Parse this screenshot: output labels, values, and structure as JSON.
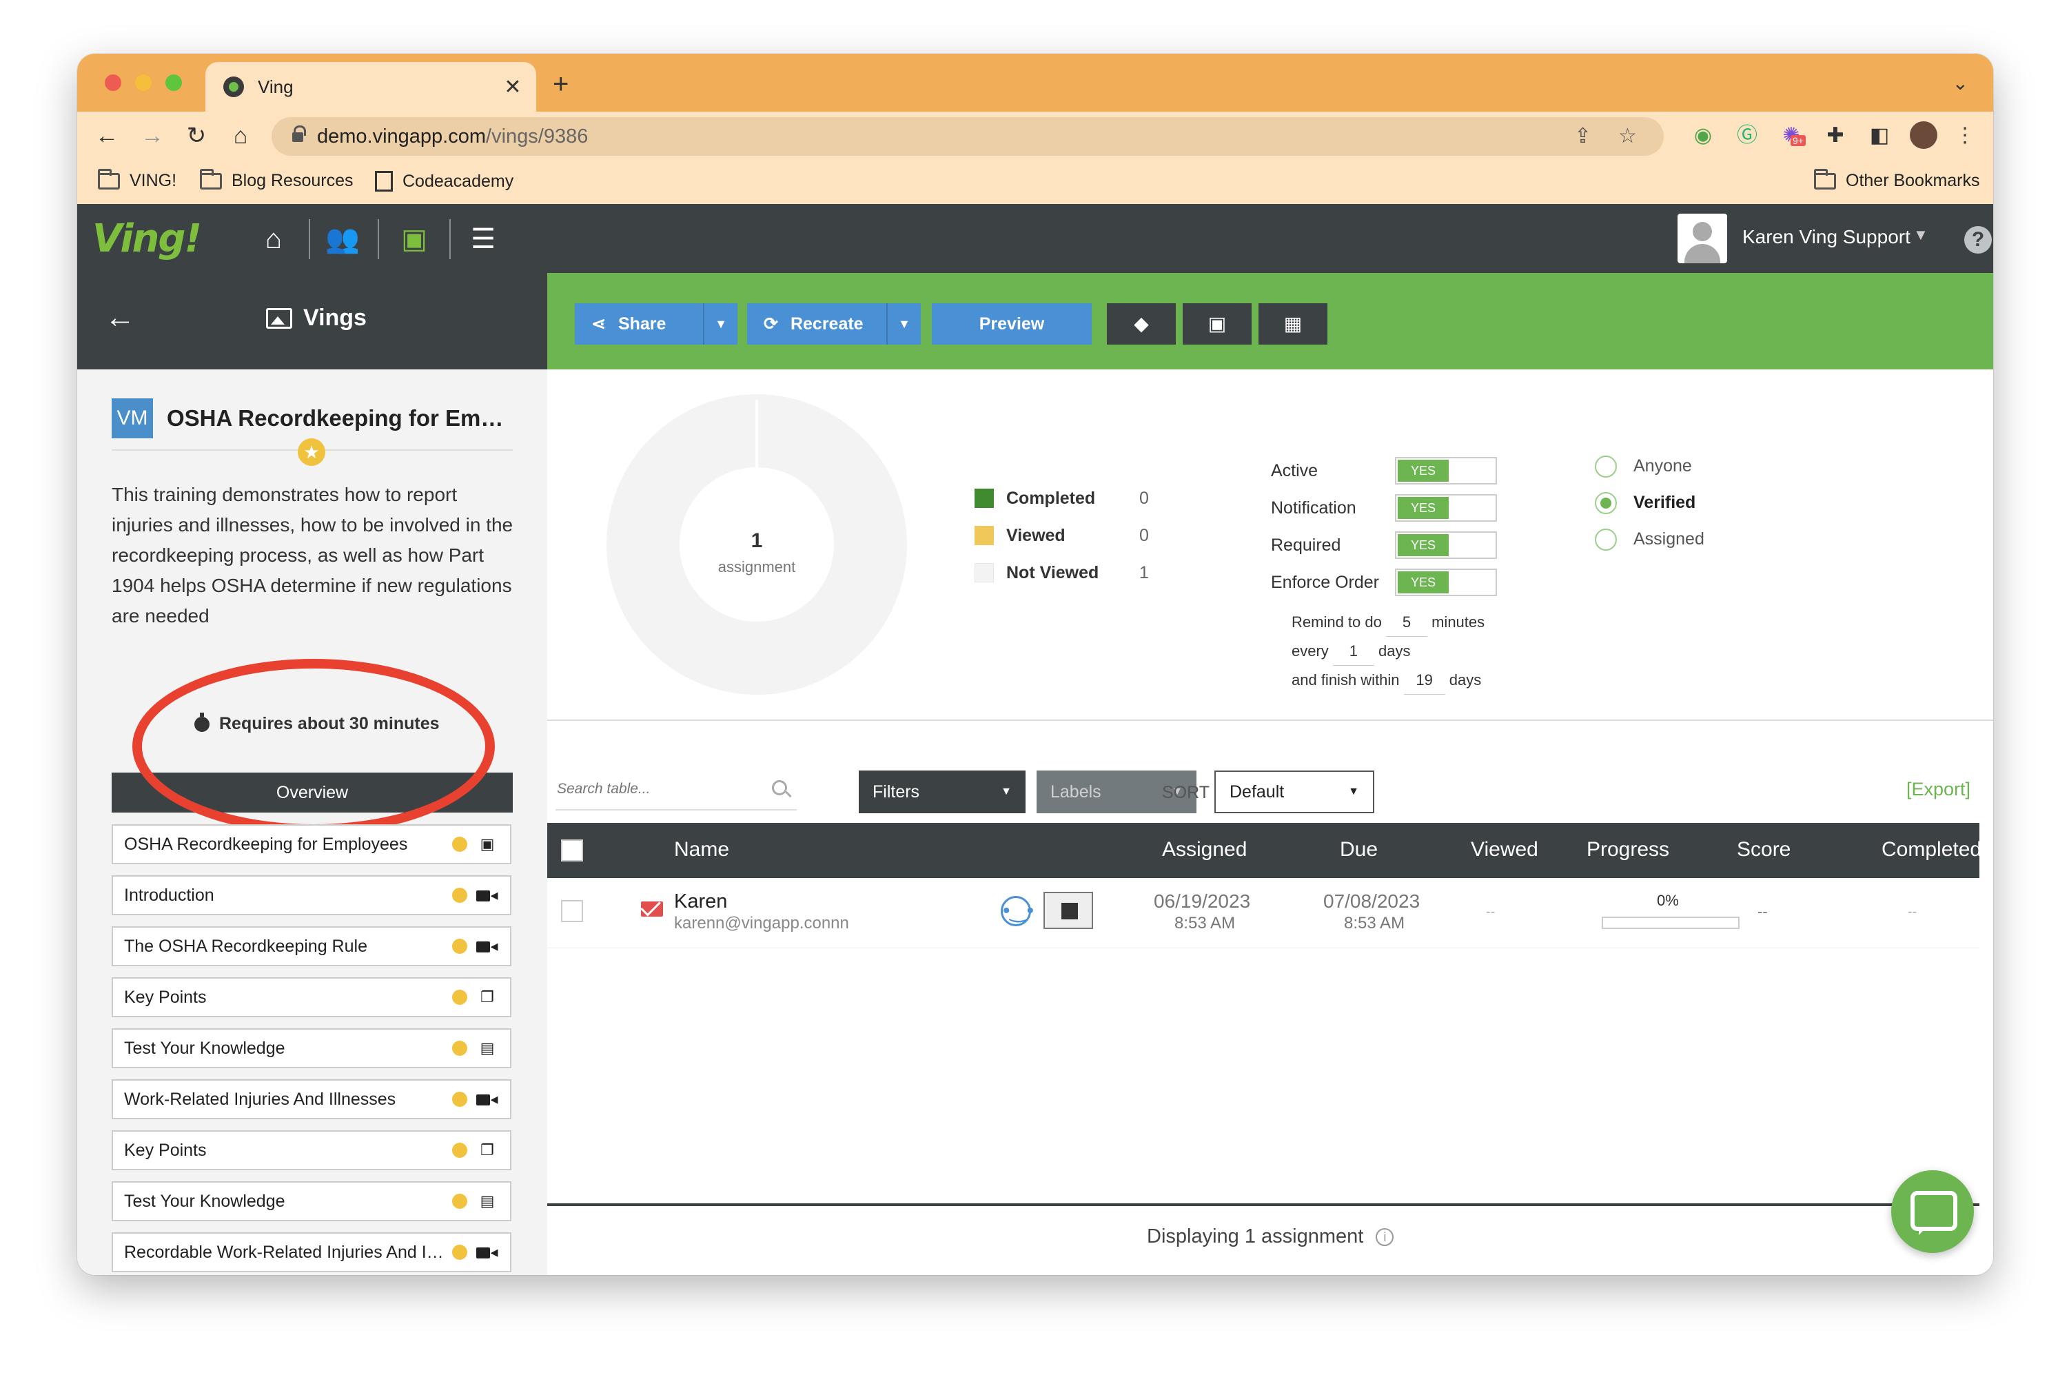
{
  "browser": {
    "tab_title": "Ving",
    "url_domain": "demo.vingapp.com",
    "url_path": "/vings/9386",
    "bookmarks": [
      "VING!",
      "Blog Resources",
      "Codeacademy"
    ],
    "other_bookmarks": "Other Bookmarks",
    "extension_badge": "9+"
  },
  "app": {
    "logo": "Ving!",
    "user_name": "Karen Ving Support"
  },
  "sidebar": {
    "header_title": "Vings",
    "badge": "VM",
    "ving_title": "OSHA Recordkeeping for Employ...",
    "description": "This training demonstrates how to report injuries and illnesses, how to be involved in the recordkeeping process, as well as how Part 1904 helps OSHA determine if new regulations are needed",
    "requires": "Requires about 30 minutes",
    "overview_label": "Overview",
    "sections": [
      {
        "label": "OSHA Recordkeeping for Employees",
        "icon": "image-icon"
      },
      {
        "label": "Introduction",
        "icon": "video-icon"
      },
      {
        "label": "The OSHA Recordkeeping Rule",
        "icon": "video-icon"
      },
      {
        "label": "Key Points",
        "icon": "copy-icon"
      },
      {
        "label": "Test Your Knowledge",
        "icon": "clipboard-icon"
      },
      {
        "label": "Work-Related Injuries And Illnesses",
        "icon": "video-icon"
      },
      {
        "label": "Key Points",
        "icon": "copy-icon"
      },
      {
        "label": "Test Your Knowledge",
        "icon": "clipboard-icon"
      },
      {
        "label": "Recordable Work-Related Injuries And Illn...",
        "icon": "video-icon"
      }
    ]
  },
  "actions": {
    "share": "Share",
    "recreate": "Recreate",
    "preview": "Preview"
  },
  "stats": {
    "assignment_count": "1",
    "assignment_label": "assignment",
    "legend": [
      {
        "label": "Completed",
        "value": "0",
        "color": "#3f8a2f"
      },
      {
        "label": "Viewed",
        "value": "0",
        "color": "#f0c85a"
      },
      {
        "label": "Not Viewed",
        "value": "1",
        "color": "#f3f3f3"
      }
    ],
    "settings": [
      {
        "label": "Active",
        "value": "YES"
      },
      {
        "label": "Notification",
        "value": "YES"
      },
      {
        "label": "Required",
        "value": "YES"
      },
      {
        "label": "Enforce Order",
        "value": "YES"
      }
    ],
    "remind": {
      "prefix": "Remind to do",
      "minutes": "5",
      "minutes_unit": "minutes",
      "every_label": "every",
      "days": "1",
      "days_unit": "days",
      "finish_label": "and finish within",
      "finish_days": "19",
      "finish_unit": "days"
    },
    "visibility": [
      {
        "label": "Anyone",
        "selected": false
      },
      {
        "label": "Verified",
        "selected": true
      },
      {
        "label": "Assigned",
        "selected": false
      }
    ]
  },
  "table_controls": {
    "search_placeholder": "Search table...",
    "filters": "Filters",
    "labels": "Labels",
    "sort_label": "SORT",
    "sort_value": "Default",
    "export": "[Export]"
  },
  "table": {
    "headers": {
      "name": "Name",
      "assigned": "Assigned",
      "due": "Due",
      "viewed": "Viewed",
      "progress": "Progress",
      "score": "Score",
      "completed": "Completed"
    },
    "rows": [
      {
        "name": "Karen",
        "email": "karenn@vingapp.connn",
        "assigned_date": "06/19/2023",
        "assigned_time": "8:53 AM",
        "due_date": "07/08/2023",
        "due_time": "8:53 AM",
        "viewed": "--",
        "progress": "0%",
        "score": "--",
        "completed": "--"
      }
    ],
    "footer": "Displaying 1 assignment"
  },
  "colors": {
    "chrome_tab_strip": "#f1ad57",
    "header_dark": "#3c4144",
    "action_green": "#6cb551",
    "button_blue": "#4a90d4",
    "highlight_red": "#e8412f"
  }
}
